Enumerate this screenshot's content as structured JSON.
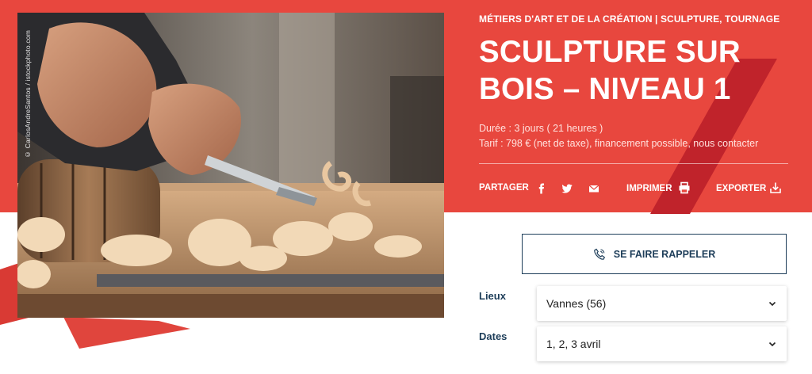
{
  "photo_credit": "© CarlosAndreSantos / istockphoto.com",
  "category": "MÉTIERS D'ART ET DE LA CRÉATION | SCULPTURE, TOURNAGE",
  "title": "SCULPTURE SUR BOIS – NIVEAU 1",
  "duree": "Durée : 3 jours ( 21 heures )",
  "tarif": "Tarif : 798 € (net de taxe), financement possible, nous contacter",
  "share": {
    "label": "PARTAGER",
    "icons": [
      "facebook-icon",
      "twitter-icon",
      "mail-icon"
    ]
  },
  "print_label": "IMPRIMER",
  "export_label": "EXPORTER",
  "callback_label": "SE FAIRE RAPPELER",
  "lieux": {
    "label": "Lieux",
    "value": "Vannes (56)"
  },
  "dates": {
    "label": "Dates",
    "value": "1, 2, 3 avril"
  },
  "colors": {
    "accent": "#e8473e",
    "accent_dark": "#b8202a",
    "navy": "#1d3d59"
  }
}
